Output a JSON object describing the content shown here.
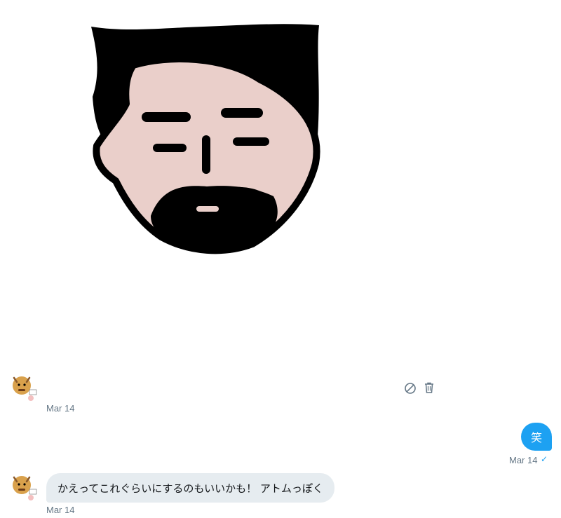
{
  "messages": [
    {
      "sender": "other",
      "kind": "image",
      "timestamp": "Mar 14"
    },
    {
      "sender": "me",
      "kind": "text",
      "text": "笑",
      "timestamp": "Mar 14",
      "status": "✓"
    },
    {
      "sender": "other",
      "kind": "text",
      "text": "かえってこれぐらいにするのもいいかも！ アトムっぽく",
      "timestamp": "Mar 14"
    }
  ],
  "actions": {
    "block_icon": "block-icon",
    "delete_icon": "trash-icon"
  },
  "colors": {
    "accent": "#1da1f2",
    "incoming_bubble": "#e6ecf0",
    "timestamp": "#657786",
    "skin": "#eacfca",
    "hair": "#000000"
  }
}
